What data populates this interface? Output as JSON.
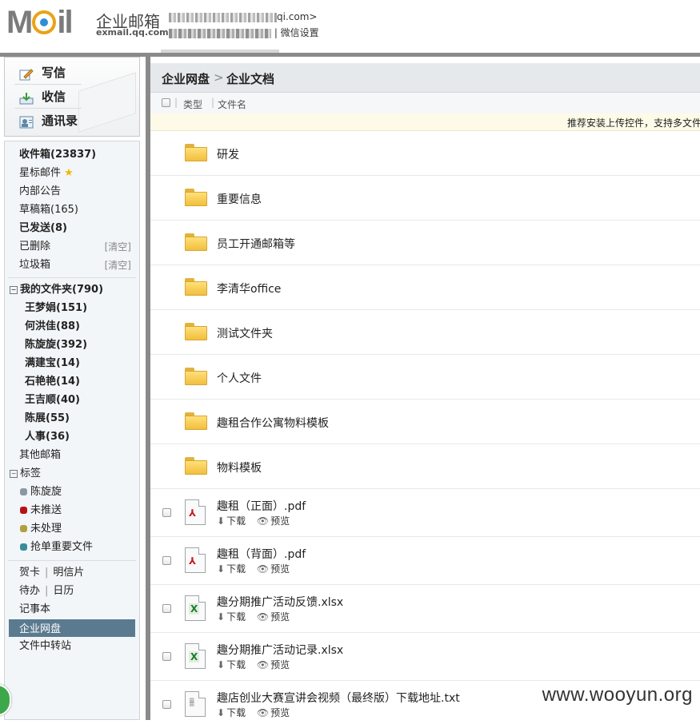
{
  "header": {
    "brand_cn": "企业邮箱",
    "brand_en": "exmail.qq.com",
    "account_email_suffix": "qi.com>",
    "wechat_settings": "微信设置"
  },
  "quick_actions": [
    {
      "label": "写信",
      "icon": "pencil-icon"
    },
    {
      "label": "收信",
      "icon": "download-icon"
    },
    {
      "label": "通讯录",
      "icon": "contacts-icon"
    }
  ],
  "nav": {
    "inbox": "收件箱(23837)",
    "starred": "星标邮件",
    "internal": "内部公告",
    "drafts": "草稿箱(165)",
    "sent": "已发送(8)",
    "deleted": "已删除",
    "spam": "垃圾箱",
    "clear_label": "[清空]",
    "my_folders": "我的文件夹(790)",
    "folders": [
      "王梦娟(151)",
      "何洪佳(88)",
      "陈旋旋(392)",
      "满建宝(14)",
      "石艳艳(14)",
      "王吉顺(40)",
      "陈展(55)",
      "人事(36)"
    ],
    "other_mailbox": "其他邮箱",
    "tags_title": "标签",
    "tags": [
      {
        "label": "陈旋旋",
        "color": "#8a98a4"
      },
      {
        "label": "未推送",
        "color": "#b4131a"
      },
      {
        "label": "未处理",
        "color": "#b0a03c"
      },
      {
        "label": "抢单重要文件",
        "color": "#3a8c9a"
      }
    ],
    "greeting_card": "贺卡",
    "postcard": "明信片",
    "todo": "待办",
    "calendar": "日历",
    "notebook": "记事本",
    "netdisk": "企业网盘",
    "transfer": "文件中转站"
  },
  "main": {
    "breadcrumb_root": "企业网盘",
    "breadcrumb_sep": ">",
    "breadcrumb_current": "企业文档",
    "col_type": "类型",
    "col_name": "文件名",
    "notice": "推荐安装上传控件，支持多文件",
    "folders": [
      "研发",
      "重要信息",
      "员工开通邮箱等",
      "李清华office",
      "测试文件夹",
      "个人文件",
      "趣租合作公寓物料模板",
      "物料模板"
    ],
    "files": [
      {
        "name": "趣租（正面）.pdf",
        "icon": "pdf-icon"
      },
      {
        "name": "趣租（背面）.pdf",
        "icon": "pdf-icon"
      },
      {
        "name": "趣分期推广活动反馈.xlsx",
        "icon": "excel-icon"
      },
      {
        "name": "趣分期推广活动记录.xlsx",
        "icon": "excel-icon"
      },
      {
        "name": "趣店创业大赛宣讲会视频（最终版）下载地址.txt",
        "icon": "text-file-icon"
      }
    ],
    "download_label": "下载",
    "preview_label": "预览"
  },
  "watermark": "www.wooyun.org"
}
